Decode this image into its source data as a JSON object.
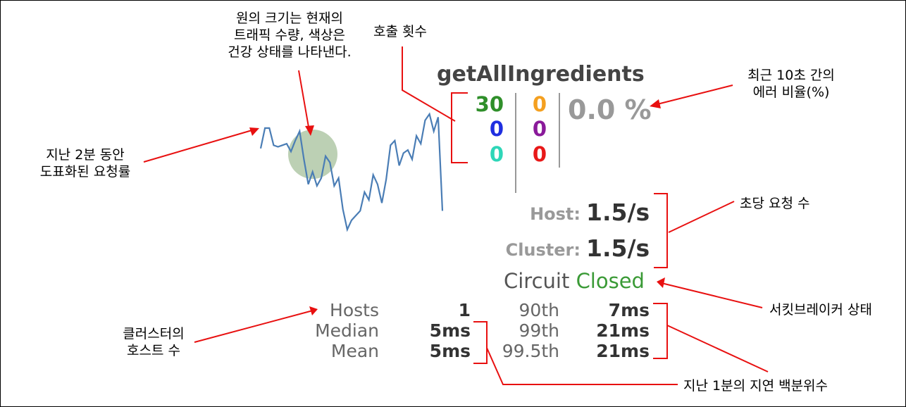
{
  "dashboard": {
    "title": "getAllIngredients",
    "counts": {
      "col1": [
        {
          "value": "30",
          "color": "#2f8f2a"
        },
        {
          "value": "0",
          "color": "#1f2fe0"
        },
        {
          "value": "0",
          "color": "#2ed6b8"
        }
      ],
      "col2": [
        {
          "value": "0",
          "color": "#f4a020"
        },
        {
          "value": "0",
          "color": "#8a1a9a"
        },
        {
          "value": "0",
          "color": "#e81818"
        }
      ]
    },
    "error_pct": "0.0 %",
    "host_label": "Host:",
    "host_rate": "1.5/s",
    "cluster_label": "Cluster:",
    "cluster_rate": "1.5/s",
    "circuit_label": "Circuit",
    "circuit_status": "Closed",
    "circuit_status_color": "#3a9a36",
    "stats": {
      "left_labels": [
        "Hosts",
        "Median",
        "Mean"
      ],
      "left_values": [
        "1",
        "5ms",
        "5ms"
      ],
      "right_labels": [
        "90th",
        "99th",
        "99.5th"
      ],
      "right_values": [
        "7ms",
        "21ms",
        "21ms"
      ]
    }
  },
  "annotations": {
    "circle": [
      "원의 크기는 현재의",
      "트래픽 수량, 색상은",
      "건강 상태를 나타낸다."
    ],
    "calls": "호출 횟수",
    "error_rate": [
      "최근 10초 간의",
      "에러 비율(%)"
    ],
    "request_rate_graph": [
      "지난 2분 동안",
      "도표화된 요청률"
    ],
    "rps": "초당 요청 수",
    "circuit_state": "서킷브레이커 상태",
    "cluster_hosts": [
      "클러스터의",
      "호스트 수"
    ],
    "latency": "지난 1분의 지연 백분위수"
  },
  "chart_data": {
    "type": "line",
    "title": "",
    "xlabel": "",
    "ylabel": "",
    "series": [
      {
        "values": [
          52,
          65,
          65,
          54,
          53,
          54,
          55,
          50,
          57,
          63,
          45,
          29,
          37,
          28,
          33,
          47,
          43,
          28,
          33,
          13,
          0,
          6,
          9,
          12,
          24,
          19,
          35,
          29,
          17,
          32,
          54,
          57,
          41,
          49,
          51,
          45,
          60,
          55,
          70,
          74,
          63,
          72,
          12
        ]
      }
    ],
    "circle_color": "#bcd0b4"
  }
}
